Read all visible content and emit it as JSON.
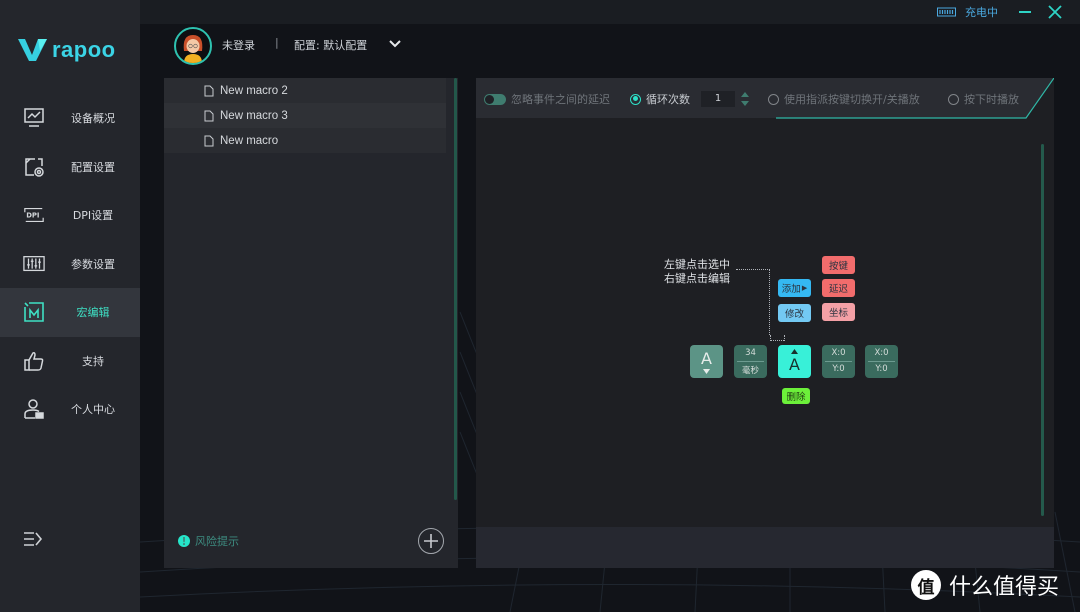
{
  "app": {
    "brand": "rapoo",
    "charging_status": "充电中",
    "colors": {
      "accent": "#2ee0c8",
      "brand": "#3bd4e6",
      "sidebar": "#24262c",
      "panel": "#1e1f23"
    }
  },
  "header": {
    "user_label": "未登录",
    "separator": "|",
    "config_label": "配置: 默认配置"
  },
  "sidebar": {
    "items": [
      {
        "label": "设备概况",
        "icon": "monitor-chart-icon",
        "active": false
      },
      {
        "label": "配置设置",
        "icon": "config-gear-icon",
        "active": false
      },
      {
        "label": "DPI设置",
        "icon": "dpi-icon",
        "active": false
      },
      {
        "label": "参数设置",
        "icon": "sliders-icon",
        "active": false
      },
      {
        "label": "宏编辑",
        "icon": "macro-icon",
        "active": true
      },
      {
        "label": "支持",
        "icon": "thumbs-up-icon",
        "active": false
      },
      {
        "label": "个人中心",
        "icon": "user-icon",
        "active": false
      }
    ]
  },
  "macro_list": {
    "items": [
      "New macro 2",
      "New macro 3",
      "New macro"
    ],
    "risk_label": "风险提示",
    "risk_icon_glyph": "!"
  },
  "toolbar": {
    "ignore_delay_label": "忽略事件之间的延迟",
    "loop_count_label": "循环次数",
    "loop_count_value": "1",
    "toggle_play_label": "使用指派按键切换开/关播放",
    "hold_play_label": "按下时播放"
  },
  "editor": {
    "hint_line1": "左键点击选中",
    "hint_line2": "右键点击编辑",
    "add_label": "添加",
    "modify_label": "修改",
    "key_label": "按键",
    "delay_label": "延迟",
    "coord_label": "坐标",
    "delete_label": "删除",
    "nodes": [
      {
        "type": "key-down",
        "key": "A"
      },
      {
        "type": "delay",
        "value": "34",
        "unit": "毫秒"
      },
      {
        "type": "key-up",
        "key": "A",
        "selected": true
      },
      {
        "type": "coord",
        "x": "X:0",
        "y": "Y:0"
      },
      {
        "type": "coord",
        "x": "X:0",
        "y": "Y:0"
      }
    ]
  },
  "watermark": {
    "badge": "值",
    "text": "什么值得买"
  }
}
